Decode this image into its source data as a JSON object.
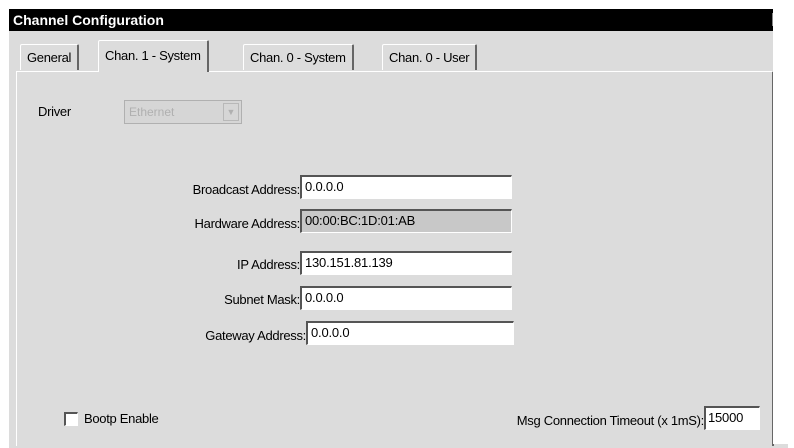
{
  "window": {
    "title": "Channel Configuration",
    "close_glyph": "×"
  },
  "tabs": [
    {
      "label": "General",
      "active": false
    },
    {
      "label": "Chan. 1 - System",
      "active": true
    },
    {
      "label": "Chan. 0 - System",
      "active": false
    },
    {
      "label": "Chan. 0 - User",
      "active": false
    }
  ],
  "driver": {
    "label": "Driver",
    "value": "Ethernet",
    "enabled": false
  },
  "fields": {
    "broadcast": {
      "label": "Broadcast Address:",
      "value": "0.0.0.0"
    },
    "hardware": {
      "label": "Hardware Address:",
      "value": "00:00:BC:1D:01:AB"
    },
    "ip": {
      "label": "IP Address:",
      "value": "130.151.81.139"
    },
    "subnet": {
      "label": "Subnet Mask:",
      "value": "0.0.0.0"
    },
    "gateway": {
      "label": "Gateway Address:",
      "value": "0.0.0.0"
    }
  },
  "bootp": {
    "label": "Bootp Enable",
    "checked": false
  },
  "msg_timeout": {
    "label": "Msg Connection Timeout (x 1mS):",
    "value": "15000"
  }
}
